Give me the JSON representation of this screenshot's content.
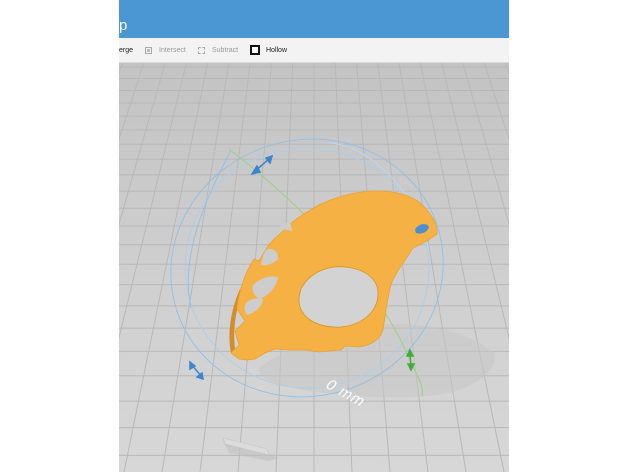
{
  "titlebar": {
    "title_fragment": "p",
    "color": "#4a97d4"
  },
  "toolbar": {
    "merge_label": "erge",
    "intersect_label": "Intersect",
    "subtract_label": "Subtract",
    "hollow_label": "Hollow"
  },
  "viewport": {
    "dimension_label": "0 mm",
    "model_color": "#f5b144",
    "ground_color": "#cfcfcf",
    "grid_color": "#b8b8b8"
  },
  "icons": {
    "intersect": "intersect-icon",
    "subtract": "subtract-icon",
    "hollow": "hollow-icon",
    "resize_handle": "resize-arrow-icon"
  }
}
